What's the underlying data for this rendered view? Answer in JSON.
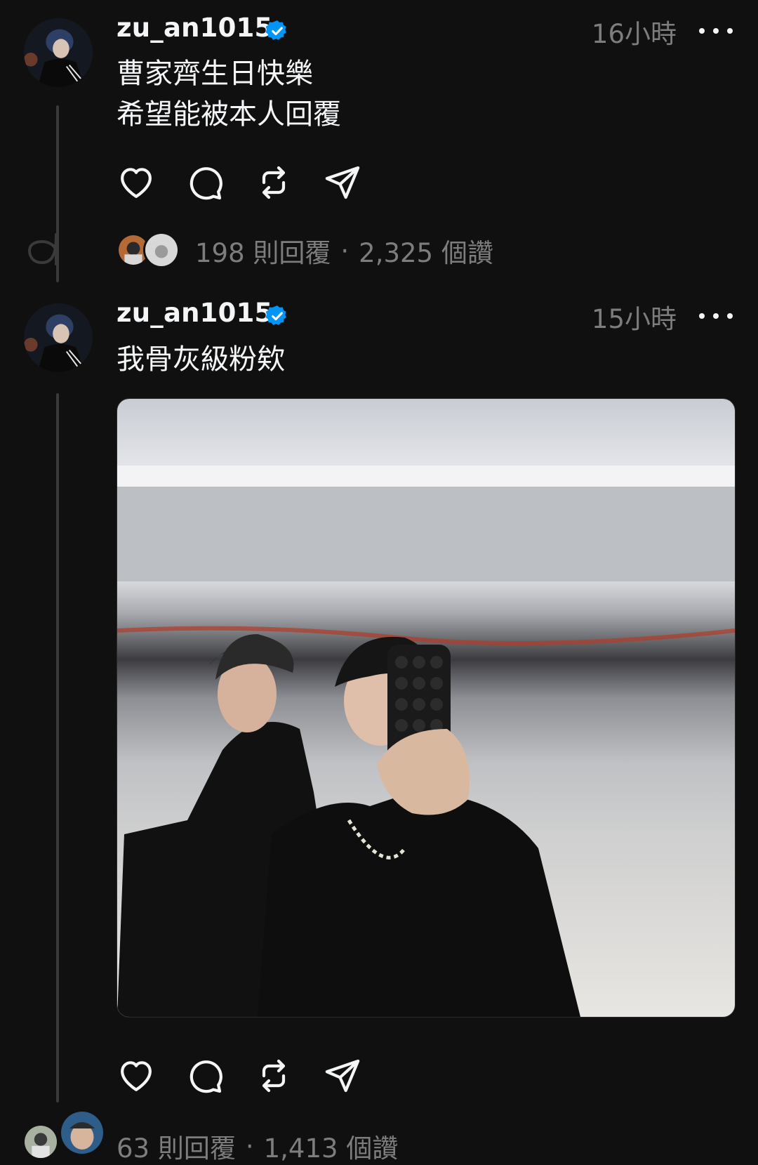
{
  "posts": [
    {
      "username": "zu_an1015",
      "time": "16小時",
      "lines": [
        "曹家齊生日快樂",
        "希望能被本人回覆"
      ],
      "replies": "198 則回覆",
      "separator": "·",
      "likes": "2,325 個讚"
    },
    {
      "username": "zu_an1015",
      "time": "15小時",
      "lines": [
        "我骨灰級粉欸"
      ],
      "replies": "63 則回覆",
      "separator": "·",
      "likes": "1,413 個讚"
    }
  ],
  "icons": {
    "like": "heart-icon",
    "reply": "comment-icon",
    "repost": "repost-icon",
    "share": "send-icon",
    "verified": "verified-badge-icon",
    "more": "more-icon"
  },
  "colors": {
    "background": "#101010",
    "text": "#f3f5f7",
    "muted": "#7d7d7d",
    "verified": "#0095f6",
    "thread_line": "#3a3a3a"
  }
}
